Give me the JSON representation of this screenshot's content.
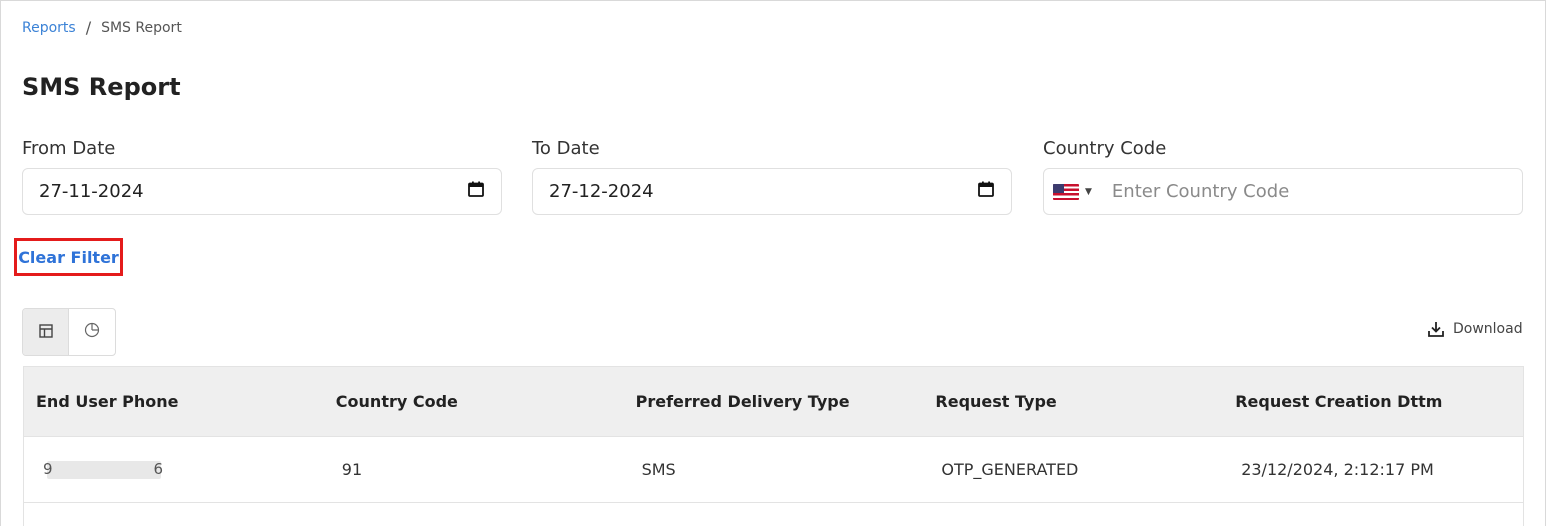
{
  "breadcrumb": {
    "parent": "Reports",
    "separator": "/",
    "current": "SMS Report"
  },
  "page_title": "SMS Report",
  "filters": {
    "from_date": {
      "label": "From Date",
      "value": "27-11-2024",
      "icon": "calendar-icon"
    },
    "to_date": {
      "label": "To Date",
      "value": "27-12-2024",
      "icon": "calendar-icon"
    },
    "country_code": {
      "label": "Country Code",
      "placeholder": "Enter Country Code",
      "flag": "us-flag-icon",
      "value": ""
    }
  },
  "clear_filter_label": "Clear Filter",
  "view_toggle": {
    "options": [
      {
        "name": "table-view",
        "icon": "table-icon",
        "active": true
      },
      {
        "name": "chart-view",
        "icon": "pie-chart-icon",
        "active": false
      }
    ]
  },
  "download_label": "Download",
  "table": {
    "columns": [
      "End User Phone",
      "Country Code",
      "Preferred Delivery Type",
      "Request Type",
      "Request Creation Dttm"
    ],
    "rows": [
      {
        "phone_first": "9",
        "phone_last": "6",
        "country_code": "91",
        "delivery_type": "SMS",
        "request_type": "OTP_GENERATED",
        "created": "23/12/2024, 2:12:17 PM"
      }
    ]
  },
  "colors": {
    "link": "#3b82d6",
    "highlight_border": "#e41b1b",
    "header_bg": "#efefef"
  }
}
